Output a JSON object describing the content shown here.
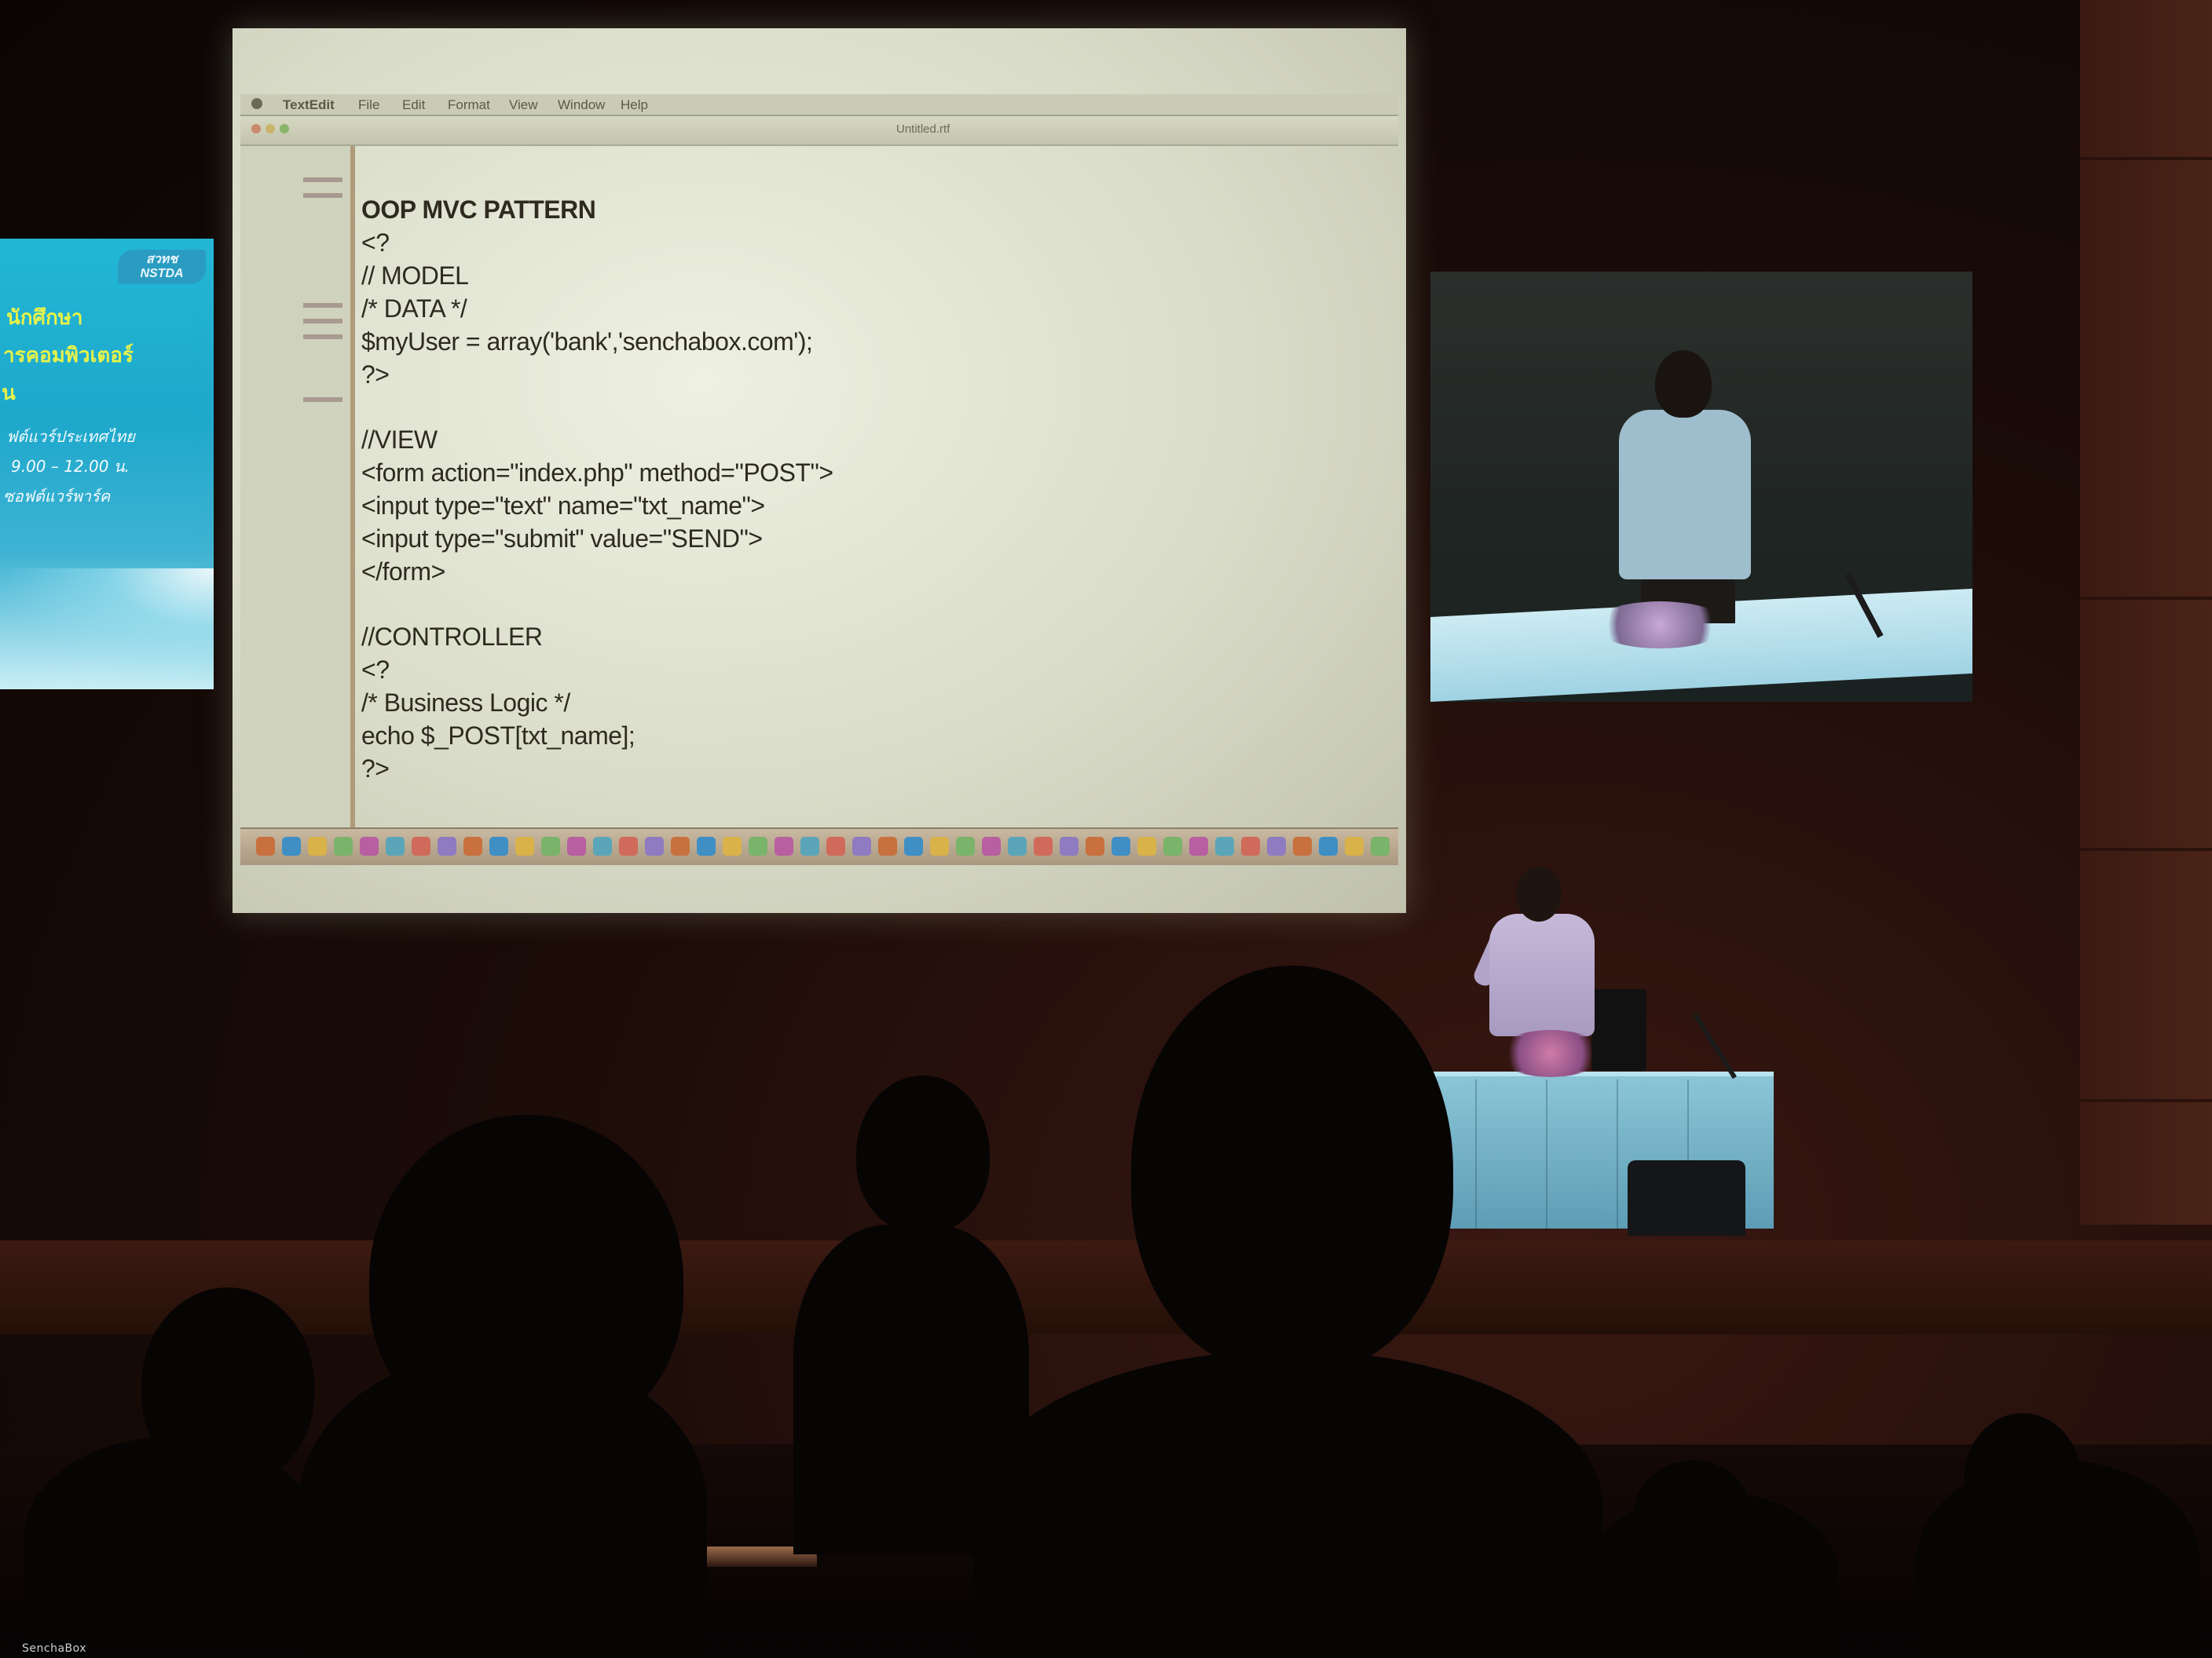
{
  "main_screen": {
    "menubar": [
      "TextEdit",
      "File",
      "Edit",
      "Format",
      "View",
      "Window",
      "Help"
    ],
    "window_title": "Untitled.rtf",
    "code_lines": [
      "OOP MVC PATTERN",
      "<?",
      "// MODEL",
      "/* DATA */",
      "$myUser = array('bank','senchabox.com');",
      "?>",
      "",
      "//VIEW",
      "<form action=\"index.php\" method=\"POST\">",
      "<input type=\"text\" name=\"txt_name\">",
      "<input type=\"submit\" value=\"SEND\">",
      "</form>",
      "",
      "//CONTROLLER",
      "<?",
      "/* Business Logic */",
      "echo $_POST[txt_name];",
      "?>"
    ]
  },
  "left_screen": {
    "lines": [
      "นักศึกษา",
      "ารคอมพิวเตอร์",
      "น",
      "ฟต์แวร์ประเทศไทย",
      "9.00 – 12.00 น.",
      "ซอฟต์แวร์พาร์ค"
    ],
    "logo": [
      "สวทช",
      "NSTDA"
    ]
  },
  "watermark": "SenchaBox",
  "colors": {
    "screen_glow": "#e6e9d6",
    "left_screen_blue": "#22b7d6",
    "left_heading_yellow": "#e6f24a",
    "table_cloth": "#8cc6d8",
    "speaker_shirt": "#c6b9d8",
    "room": "#1c0c08"
  },
  "icons": [
    "microphone",
    "laptop",
    "flowers"
  ]
}
